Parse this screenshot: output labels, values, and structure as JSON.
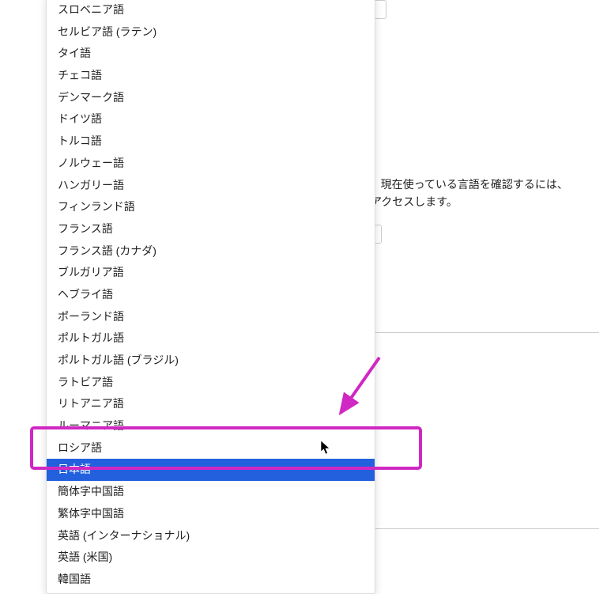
{
  "background": {
    "text_line1": "す。現在使っている言語を確認するには、",
    "text_line2": "こアクセスします。"
  },
  "dropdown": {
    "items": [
      {
        "label": "スロベニア語",
        "selected": false
      },
      {
        "label": "セルビア語 (ラテン)",
        "selected": false
      },
      {
        "label": "タイ語",
        "selected": false
      },
      {
        "label": "チェコ語",
        "selected": false
      },
      {
        "label": "デンマーク語",
        "selected": false
      },
      {
        "label": "ドイツ語",
        "selected": false
      },
      {
        "label": "トルコ語",
        "selected": false
      },
      {
        "label": "ノルウェー語",
        "selected": false
      },
      {
        "label": "ハンガリー語",
        "selected": false
      },
      {
        "label": "フィンランド語",
        "selected": false
      },
      {
        "label": "フランス語",
        "selected": false
      },
      {
        "label": "フランス語 (カナダ)",
        "selected": false
      },
      {
        "label": "ブルガリア語",
        "selected": false
      },
      {
        "label": "ヘブライ語",
        "selected": false
      },
      {
        "label": "ポーランド語",
        "selected": false
      },
      {
        "label": "ポルトガル語",
        "selected": false
      },
      {
        "label": "ポルトガル語 (ブラジル)",
        "selected": false
      },
      {
        "label": "ラトビア語",
        "selected": false
      },
      {
        "label": "リトアニア語",
        "selected": false
      },
      {
        "label": "ルーマニア語",
        "selected": false
      },
      {
        "label": "ロシア語",
        "selected": false
      },
      {
        "label": "日本語",
        "selected": true
      },
      {
        "label": "簡体字中国語",
        "selected": false
      },
      {
        "label": "繁体字中国語",
        "selected": false
      },
      {
        "label": "英語 (インターナショナル)",
        "selected": false
      },
      {
        "label": "英語 (米国)",
        "selected": false
      },
      {
        "label": "韓国語",
        "selected": false
      }
    ]
  },
  "annotation": {
    "highlight_color": "#d028c3",
    "arrow_color": "#d028c3"
  }
}
